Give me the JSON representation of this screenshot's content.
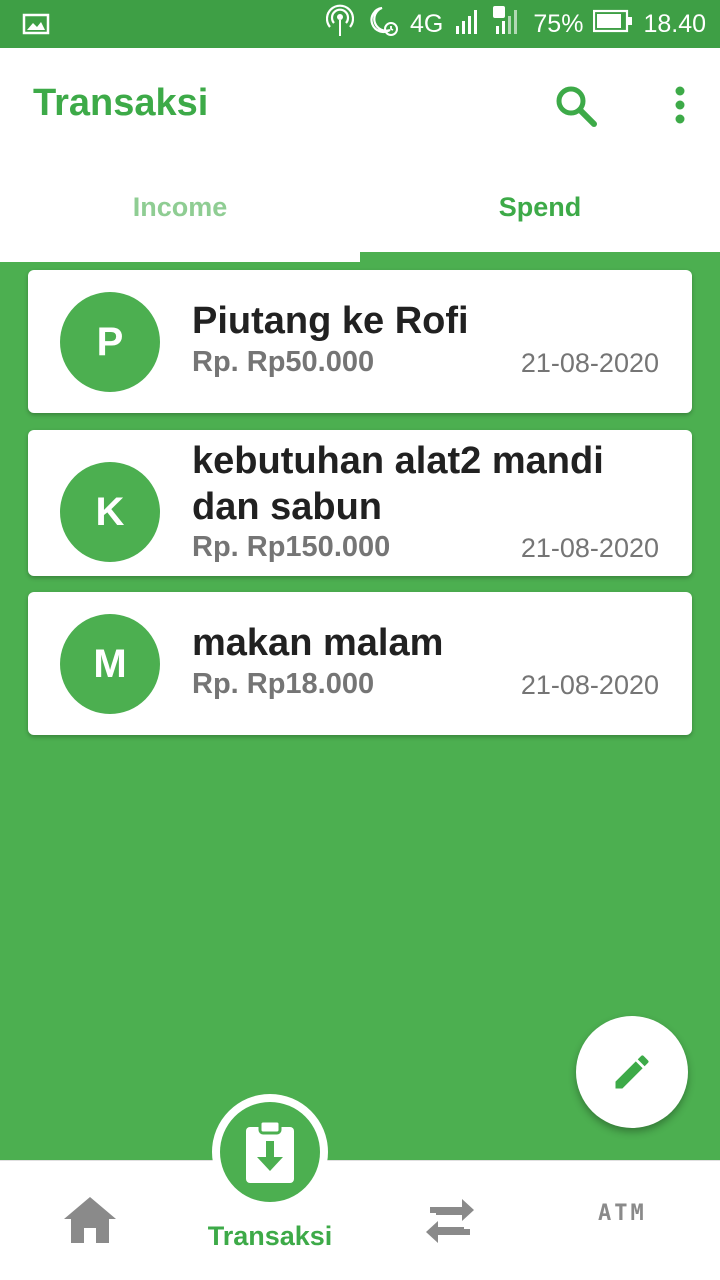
{
  "statusbar": {
    "battery": "75%",
    "time": "18.40",
    "network": "4G",
    "sim_badge_1": "1",
    "sim_badge_2": "2"
  },
  "header": {
    "title": "Transaksi"
  },
  "tabs": [
    {
      "label": "Income"
    },
    {
      "label": "Spend"
    }
  ],
  "transactions": [
    {
      "initial": "P",
      "title": "Piutang ke Rofi",
      "amount": "Rp. Rp50.000",
      "date": "21-08-2020"
    },
    {
      "initial": "K",
      "title": "kebutuhan alat2 mandi dan sabun",
      "amount": "Rp. Rp150.000",
      "date": "21-08-2020"
    },
    {
      "initial": "M",
      "title": "makan malam",
      "amount": "Rp. Rp18.000",
      "date": "21-08-2020"
    }
  ],
  "bottom_nav": {
    "transaksi_label": "Transaksi",
    "atm_label": "ATM"
  },
  "colors": {
    "primary": "#4caf50",
    "status_bar": "#3e9f45",
    "text_dark": "#212121",
    "text_muted": "#757575"
  }
}
